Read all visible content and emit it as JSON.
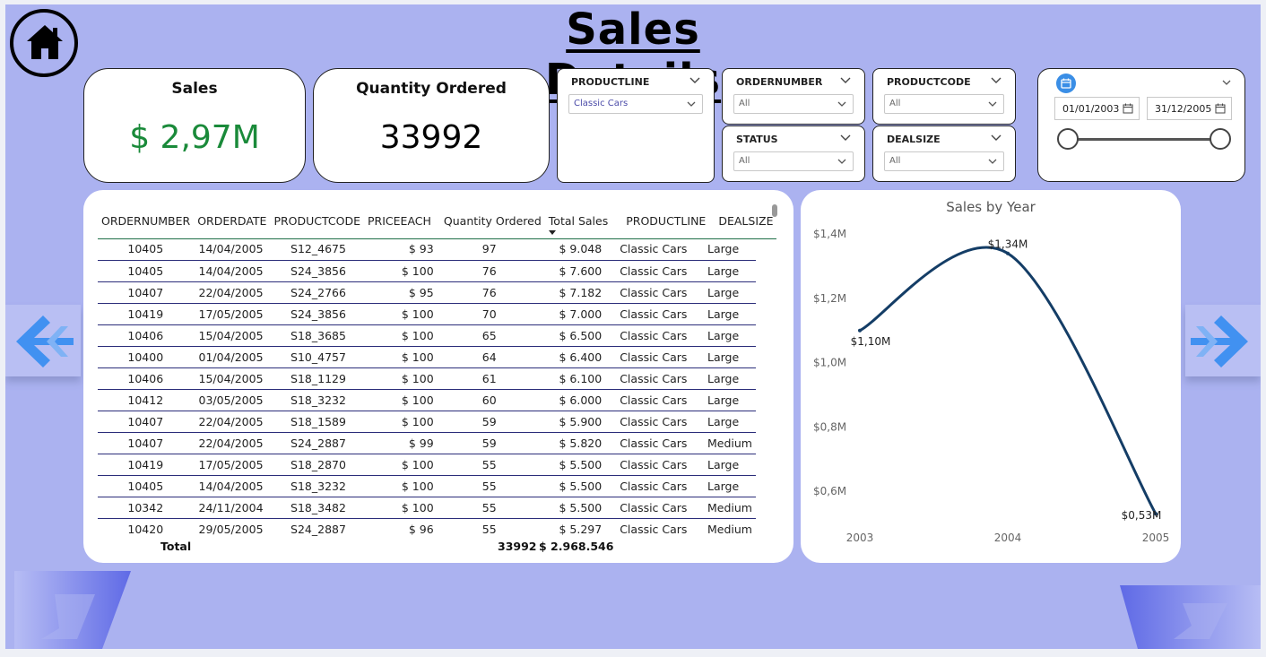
{
  "title": "Sales Details",
  "kpis": {
    "sales": {
      "label": "Sales",
      "value": "$ 2,97M",
      "color": "#1a8a3a"
    },
    "quantity": {
      "label": "Quantity Ordered",
      "value": "33992",
      "color": "#000000"
    }
  },
  "slicers": {
    "productline": {
      "title": "PRODUCTLINE",
      "value": "Classic Cars",
      "value_color": "#4a4aa8"
    },
    "ordernumber": {
      "title": "ORDERNUMBER",
      "value": "All"
    },
    "productcode": {
      "title": "PRODUCTCODE",
      "value": "All"
    },
    "status": {
      "title": "STATUS",
      "value": "All"
    },
    "dealsize": {
      "title": "DEALSIZE",
      "value": "All"
    }
  },
  "date_range": {
    "start": "01/01/2003",
    "end": "31/12/2005",
    "icon_color": "#3a8ee6"
  },
  "table": {
    "columns": [
      "ORDERNUMBER",
      "ORDERDATE",
      "PRODUCTCODE",
      "PRICEEACH",
      "Quantity Ordered",
      "Total Sales",
      "PRODUCTLINE",
      "DEALSIZE"
    ],
    "sorted_column": "Total Sales",
    "rows": [
      [
        "10405",
        "14/04/2005",
        "S12_4675",
        "$ 93",
        "97",
        "$ 9.048",
        "Classic Cars",
        "Large"
      ],
      [
        "10405",
        "14/04/2005",
        "S24_3856",
        "$ 100",
        "76",
        "$ 7.600",
        "Classic Cars",
        "Large"
      ],
      [
        "10407",
        "22/04/2005",
        "S24_2766",
        "$ 95",
        "76",
        "$ 7.182",
        "Classic Cars",
        "Large"
      ],
      [
        "10419",
        "17/05/2005",
        "S24_3856",
        "$ 100",
        "70",
        "$ 7.000",
        "Classic Cars",
        "Large"
      ],
      [
        "10406",
        "15/04/2005",
        "S18_3685",
        "$ 100",
        "65",
        "$ 6.500",
        "Classic Cars",
        "Large"
      ],
      [
        "10400",
        "01/04/2005",
        "S10_4757",
        "$ 100",
        "64",
        "$ 6.400",
        "Classic Cars",
        "Large"
      ],
      [
        "10406",
        "15/04/2005",
        "S18_1129",
        "$ 100",
        "61",
        "$ 6.100",
        "Classic Cars",
        "Large"
      ],
      [
        "10412",
        "03/05/2005",
        "S18_3232",
        "$ 100",
        "60",
        "$ 6.000",
        "Classic Cars",
        "Large"
      ],
      [
        "10407",
        "22/04/2005",
        "S18_1589",
        "$ 100",
        "59",
        "$ 5.900",
        "Classic Cars",
        "Large"
      ],
      [
        "10407",
        "22/04/2005",
        "S24_2887",
        "$ 99",
        "59",
        "$ 5.820",
        "Classic Cars",
        "Medium"
      ],
      [
        "10419",
        "17/05/2005",
        "S18_2870",
        "$ 100",
        "55",
        "$ 5.500",
        "Classic Cars",
        "Large"
      ],
      [
        "10405",
        "14/04/2005",
        "S18_3232",
        "$ 100",
        "55",
        "$ 5.500",
        "Classic Cars",
        "Large"
      ],
      [
        "10342",
        "24/11/2004",
        "S18_3482",
        "$ 100",
        "55",
        "$ 5.500",
        "Classic Cars",
        "Medium"
      ],
      [
        "10420",
        "29/05/2005",
        "S24_2887",
        "$ 96",
        "55",
        "$ 5.297",
        "Classic Cars",
        "Medium"
      ]
    ],
    "total": {
      "label": "Total",
      "quantity": "33992",
      "sales": "$ 2.968.546"
    }
  },
  "chart_data": {
    "type": "line",
    "title": "Sales by Year",
    "x": [
      "2003",
      "2004",
      "2005"
    ],
    "series": [
      {
        "values": [
          1.1,
          1.34,
          0.53
        ]
      }
    ],
    "data_labels": [
      "$1,10M",
      "$1,34M",
      "$0,53M"
    ],
    "y_ticks": [
      "$1,4M",
      "$1,2M",
      "$1,0M",
      "$0,8M",
      "$0,6M"
    ],
    "y_tick_values": [
      1.4,
      1.2,
      1.0,
      0.8,
      0.6
    ],
    "ylim": [
      0.5,
      1.42
    ],
    "line_color": "#143d66",
    "grid": false,
    "smooth": true
  },
  "icons": {
    "home": "home-icon",
    "prev": "double-chevron-left-icon",
    "next": "double-chevron-right-icon",
    "calendar": "calendar-icon"
  },
  "colors": {
    "background": "#abb2f0",
    "panel": "#ffffff",
    "arrow": "#3a8ef0",
    "accent_shape": "#5f6ae6"
  }
}
